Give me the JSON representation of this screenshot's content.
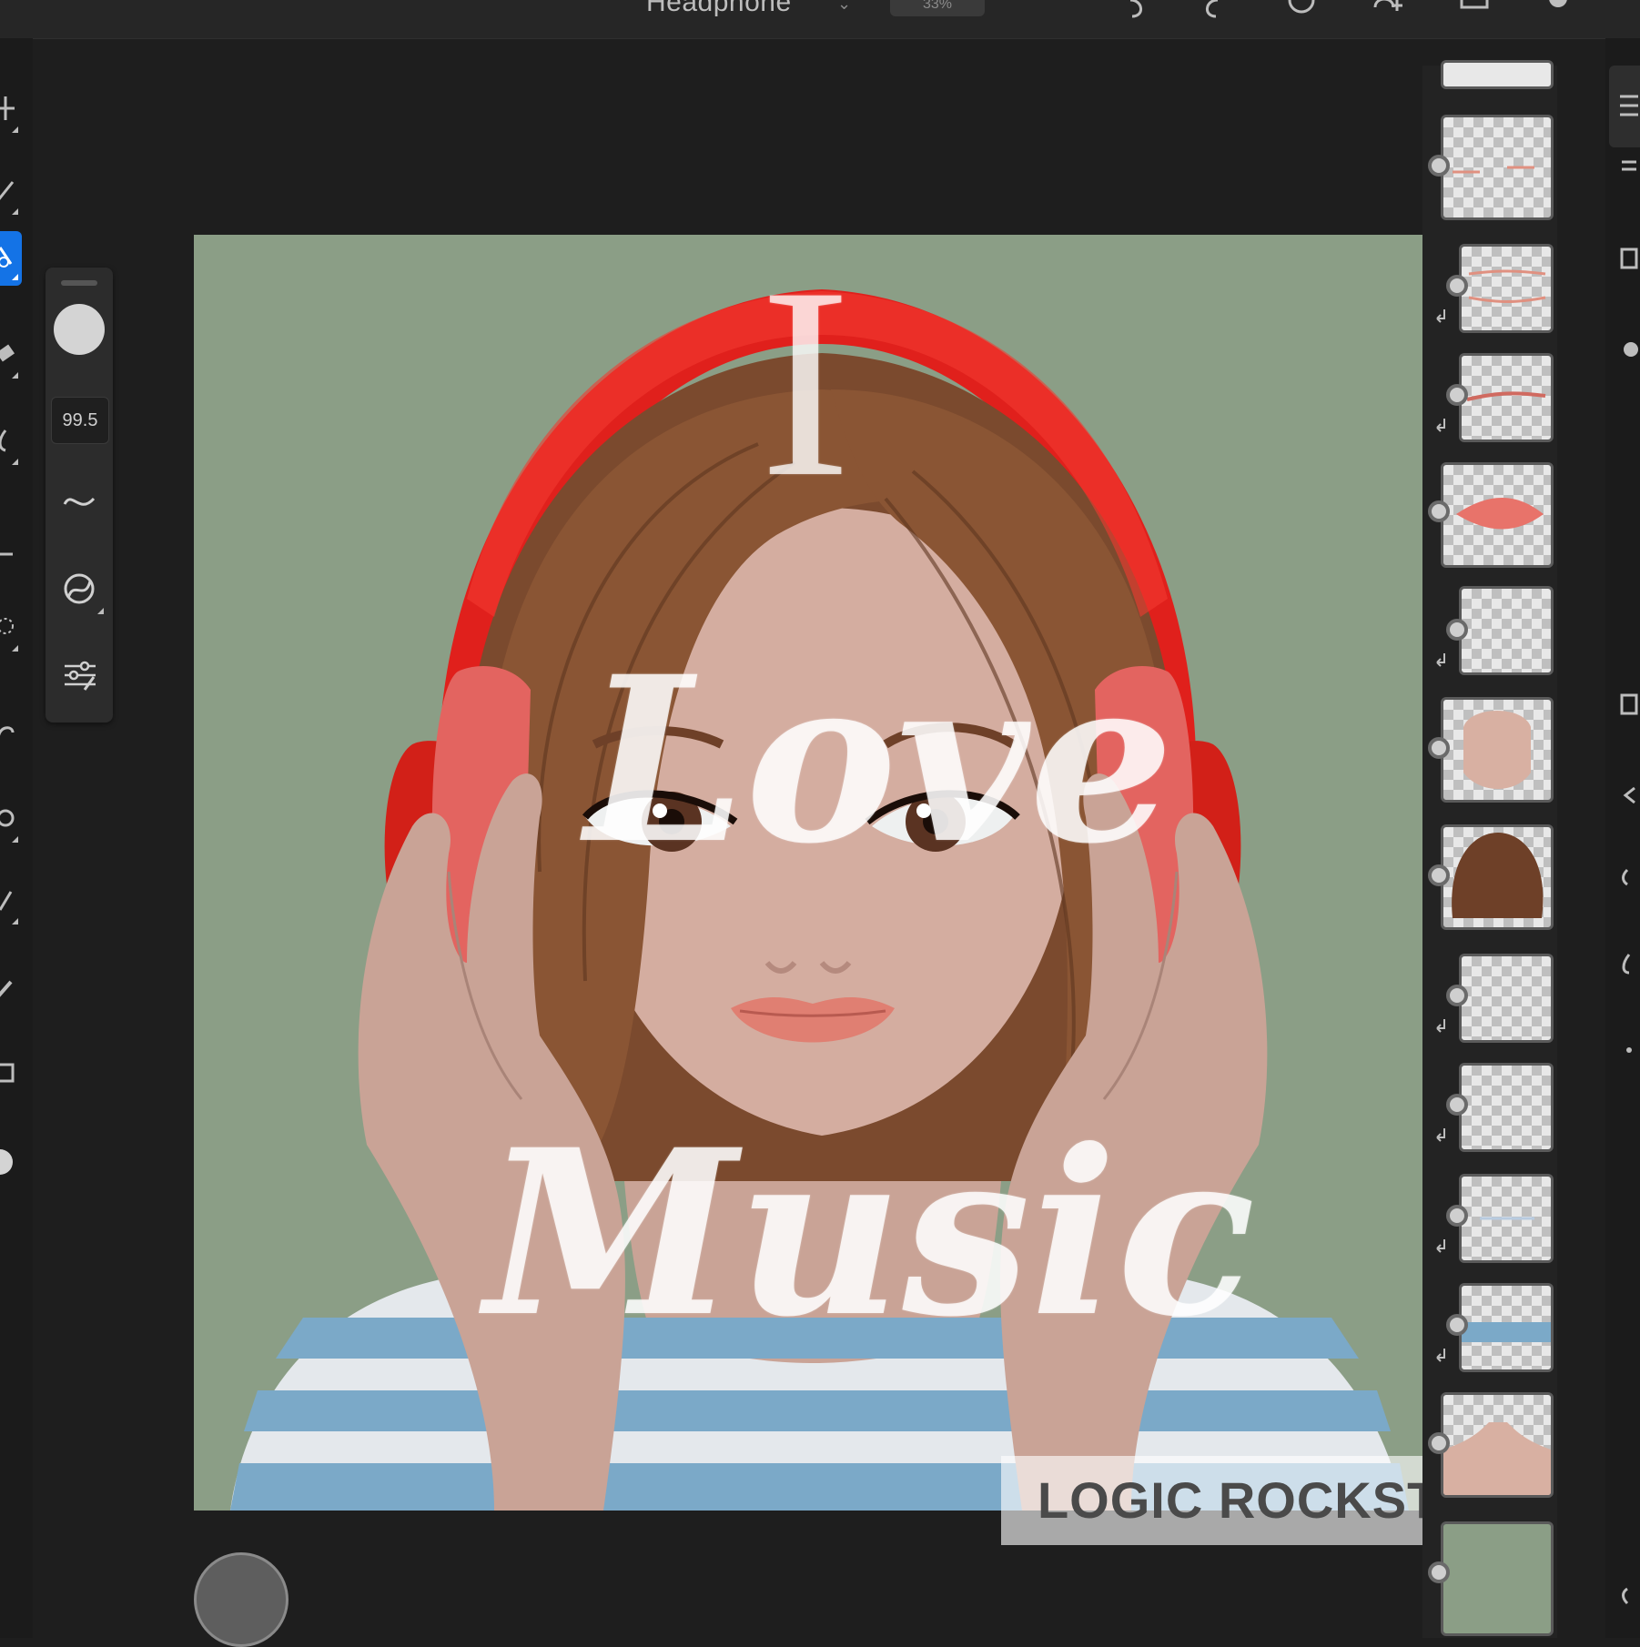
{
  "topbar": {
    "document_title": "Headphone",
    "zoom": "33%"
  },
  "tools": {
    "items": [
      "move-icon",
      "brush-icon",
      "mixer-brush-icon",
      "eraser-icon",
      "smudge-icon",
      "transform-icon",
      "lasso-icon",
      "undo-arc-icon",
      "clone-icon",
      "pen-icon",
      "pipette-icon",
      "image-icon",
      "color-swatch-icon"
    ],
    "active": "mixer-brush-icon"
  },
  "brush_panel": {
    "size_value": "99.5",
    "buttons": [
      "smoothing-icon",
      "brush-settings-icon",
      "adjust-sliders-icon"
    ]
  },
  "canvas": {
    "text_line_1": "I",
    "text_line_2": "Love",
    "text_line_3": "Music",
    "background_color": "#8b9e86"
  },
  "watermark": {
    "text": "LOGIC ROCKSTAR"
  },
  "layers": {
    "count": 13,
    "thumbnails": [
      "lash-strokes",
      "lip-lines",
      "lip-line",
      "lips",
      "face-shading",
      "face",
      "hair",
      "shadow-1",
      "shadow-2",
      "stripe-shadow",
      "shirt-stripe",
      "skin-base",
      "background"
    ]
  },
  "colors": {
    "accent": "#1473e6",
    "headphone_red": "#e0201c",
    "hair_brown": "#7b4a2e",
    "skin": "#d4ada0",
    "shirt_blue": "#7ba9c8"
  }
}
